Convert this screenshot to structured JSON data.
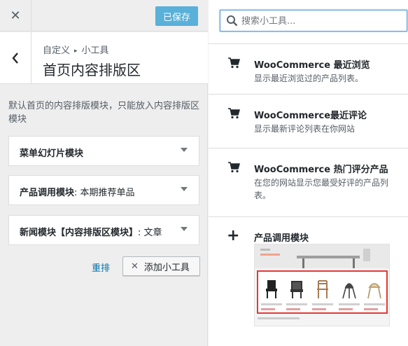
{
  "topbar": {
    "close_glyph": "✕",
    "saved_label": "已保存"
  },
  "section": {
    "back_glyph": "‹",
    "breadcrumb_root": "自定义",
    "breadcrumb_sep": "▸",
    "breadcrumb_current": "小工具",
    "title": "首页内容排版区"
  },
  "area_description": "默认首页的内容排版模块，只能放入内容排版区模块",
  "widgets": [
    {
      "name": "菜单幻灯片模块",
      "subtitle": ""
    },
    {
      "name": "产品调用模块",
      "subtitle": ": 本期推荐单品"
    },
    {
      "name": "新闻模块【内容排版区模块】",
      "subtitle": ": 文章"
    }
  ],
  "actions": {
    "reorder_label": "重排",
    "add_widget_glyph": "✕",
    "add_widget_label": "添加小工具"
  },
  "search": {
    "placeholder": "搜索小工具..."
  },
  "available_widgets": [
    {
      "icon": "cart-icon",
      "title": "WooCommerce 最近浏览",
      "desc": "显示最近浏览过的产品列表。"
    },
    {
      "icon": "cart-icon",
      "title": "WooCommerce最近评论",
      "desc": "显示最新评论列表在你网站"
    },
    {
      "icon": "cart-icon",
      "title": "WooCommerce 热门评分产品",
      "desc": "在您的网站显示您最受好评的产品列表。"
    },
    {
      "icon": "plus-icon",
      "title": "产品调用模块",
      "desc": ""
    }
  ],
  "colors": {
    "accent": "#0073aa",
    "saved_button": "#40a6d6",
    "highlight_border": "#e53935"
  }
}
